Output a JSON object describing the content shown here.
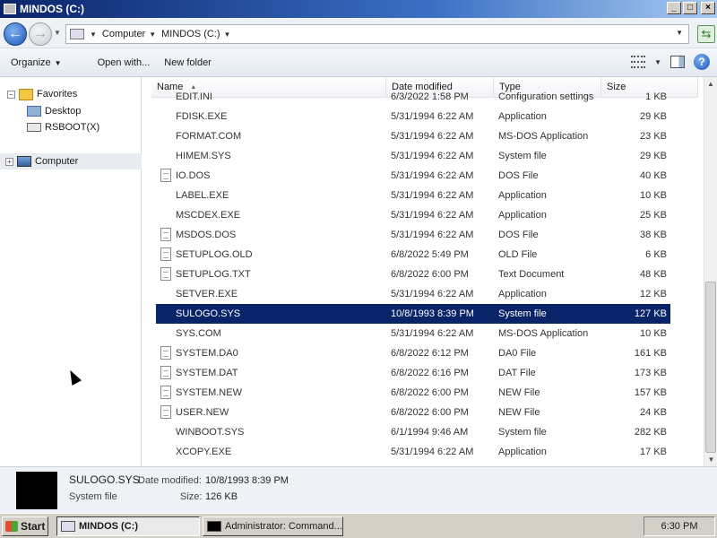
{
  "window": {
    "title": "MINDOS (C:)",
    "controls": [
      "_",
      "□",
      "×"
    ]
  },
  "address": {
    "parts": [
      "Computer",
      "MINDOS (C:)"
    ]
  },
  "toolbar": {
    "organize": "Organize",
    "open_with": "Open with...",
    "new_folder": "New folder",
    "help": "?"
  },
  "nav": {
    "favorites": "Favorites",
    "desktop": "Desktop",
    "rsboot": "RSBOOT(X)",
    "computer": "Computer"
  },
  "columns": {
    "name": "Name",
    "date": "Date modified",
    "type": "Type",
    "size": "Size"
  },
  "files": [
    {
      "name": "EDIT.INI",
      "date": "6/3/2022 1:58 PM",
      "type": "Configuration settings",
      "size": "1 KB",
      "icon": "settings-file-icon"
    },
    {
      "name": "FDISK.EXE",
      "date": "5/31/1994 6:22 AM",
      "type": "Application",
      "size": "29 KB",
      "icon": "application-icon"
    },
    {
      "name": "FORMAT.COM",
      "date": "5/31/1994 6:22 AM",
      "type": "MS-DOS Application",
      "size": "23 KB",
      "icon": "application-icon"
    },
    {
      "name": "HIMEM.SYS",
      "date": "5/31/1994 6:22 AM",
      "type": "System file",
      "size": "29 KB",
      "icon": "system-file-icon"
    },
    {
      "name": "IO.DOS",
      "date": "5/31/1994 6:22 AM",
      "type": "DOS File",
      "size": "40 KB",
      "icon": "document-icon"
    },
    {
      "name": "LABEL.EXE",
      "date": "5/31/1994 6:22 AM",
      "type": "Application",
      "size": "10 KB",
      "icon": "application-icon"
    },
    {
      "name": "MSCDEX.EXE",
      "date": "5/31/1994 6:22 AM",
      "type": "Application",
      "size": "25 KB",
      "icon": "application-icon"
    },
    {
      "name": "MSDOS.DOS",
      "date": "5/31/1994 6:22 AM",
      "type": "DOS File",
      "size": "38 KB",
      "icon": "document-icon"
    },
    {
      "name": "SETUPLOG.OLD",
      "date": "6/8/2022 5:49 PM",
      "type": "OLD File",
      "size": "6 KB",
      "icon": "document-icon"
    },
    {
      "name": "SETUPLOG.TXT",
      "date": "6/8/2022 6:00 PM",
      "type": "Text Document",
      "size": "48 KB",
      "icon": "document-icon"
    },
    {
      "name": "SETVER.EXE",
      "date": "5/31/1994 6:22 AM",
      "type": "Application",
      "size": "12 KB",
      "icon": "application-icon"
    },
    {
      "name": "SULOGO.SYS",
      "date": "10/8/1993 8:39 PM",
      "type": "System file",
      "size": "127 KB",
      "icon": "system-file-icon",
      "selected": true
    },
    {
      "name": "SYS.COM",
      "date": "5/31/1994 6:22 AM",
      "type": "MS-DOS Application",
      "size": "10 KB",
      "icon": "application-icon"
    },
    {
      "name": "SYSTEM.DA0",
      "date": "6/8/2022 6:12 PM",
      "type": "DA0 File",
      "size": "161 KB",
      "icon": "document-icon"
    },
    {
      "name": "SYSTEM.DAT",
      "date": "6/8/2022 6:16 PM",
      "type": "DAT File",
      "size": "173 KB",
      "icon": "document-icon"
    },
    {
      "name": "SYSTEM.NEW",
      "date": "6/8/2022 6:00 PM",
      "type": "NEW File",
      "size": "157 KB",
      "icon": "document-icon"
    },
    {
      "name": "USER.NEW",
      "date": "6/8/2022 6:00 PM",
      "type": "NEW File",
      "size": "24 KB",
      "icon": "document-icon"
    },
    {
      "name": "WINBOOT.SYS",
      "date": "6/1/1994 9:46 AM",
      "type": "System file",
      "size": "282 KB",
      "icon": "system-file-icon"
    },
    {
      "name": "XCOPY.EXE",
      "date": "5/31/1994 6:22 AM",
      "type": "Application",
      "size": "17 KB",
      "icon": "application-icon"
    }
  ],
  "details": {
    "filename": "SULOGO.SYS",
    "date_label": "Date modified:",
    "date_value": "10/8/1993 8:39 PM",
    "type": "System file",
    "size_label": "Size:",
    "size_value": "126 KB"
  },
  "taskbar": {
    "start": "Start",
    "tasks": [
      "MINDOS (C:)",
      "Administrator: Command..."
    ],
    "clock": "6:30 PM"
  },
  "colors": {
    "selection": "#0a246a",
    "titlebar": "#0a246a"
  }
}
